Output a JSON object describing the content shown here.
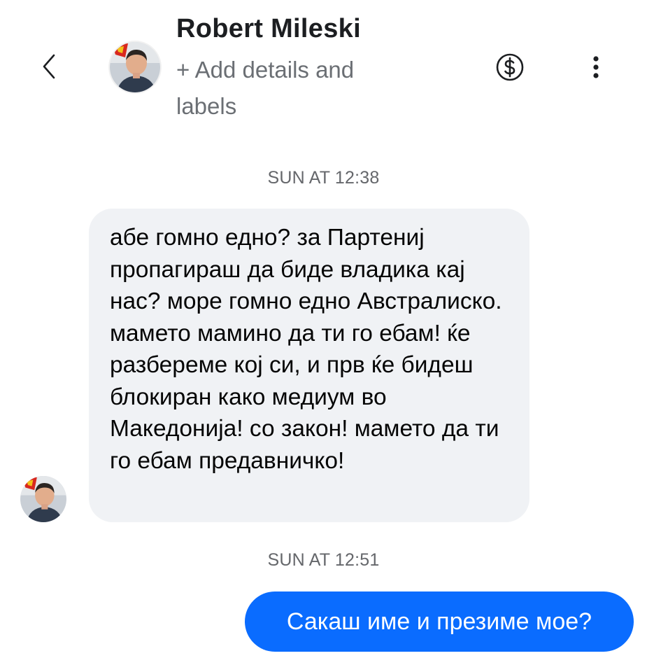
{
  "header": {
    "contact_name": "Robert Mileski",
    "add_details_label": "+ Add details and labels",
    "back_icon": "chevron-left-icon",
    "payment_icon": "dollar-circle-icon",
    "more_icon": "more-vertical-icon"
  },
  "messages": [
    {
      "timestamp": "SUN AT 12:38",
      "direction": "incoming",
      "text": "абе гомно едно? за Партениј пропагираш да биде владика кај нас? море гомно едно Австралиско. мамето мамино да ти го ебам! ќе разбереме кој си, и прв ќе бидеш блокиран како медиум во Македонија! со закон! мамето да ти го ебам предавничко!"
    },
    {
      "timestamp": "SUN AT 12:51",
      "direction": "outgoing",
      "text": "Сакаш име и презиме мое?"
    }
  ],
  "colors": {
    "incoming_bubble": "#f0f2f5",
    "outgoing_bubble": "#0a6cff",
    "timestamp_text": "#65676b",
    "secondary_text": "#6b6f74"
  }
}
